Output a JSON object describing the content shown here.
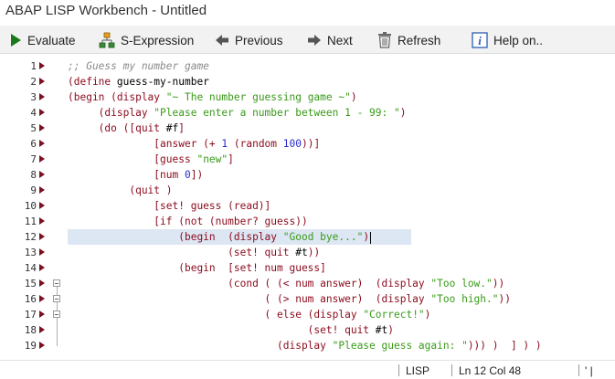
{
  "window": {
    "title": "ABAP LISP Workbench - Untitled"
  },
  "toolbar": {
    "evaluate": "Evaluate",
    "sexpression": "S-Expression",
    "previous": "Previous",
    "next": "Next",
    "refresh": "Refresh",
    "help": "Help on.."
  },
  "colors": {
    "keyword": "#8b0a1c",
    "string": "#3a9a1a",
    "number": "#2a2ad0",
    "comment": "#8a8a8a",
    "current_line": "#dde6f3"
  },
  "editor": {
    "current_line": 12,
    "lines": [
      {
        "n": "1",
        "tokens": [
          {
            "t": ";; Guess my number game",
            "c": "cm"
          }
        ]
      },
      {
        "n": "2",
        "tokens": [
          {
            "t": "(define ",
            "c": "kw"
          },
          {
            "t": "guess-my-number",
            "c": "sy"
          }
        ]
      },
      {
        "n": "3",
        "tokens": [
          {
            "t": "(begin (display ",
            "c": "kw"
          },
          {
            "t": "\"~ The number guessing game ~\"",
            "c": "st"
          },
          {
            "t": ")",
            "c": "kw"
          }
        ]
      },
      {
        "n": "4",
        "tokens": [
          {
            "t": "     (display ",
            "c": "kw"
          },
          {
            "t": "\"Please enter a number between 1 - 99: \"",
            "c": "st"
          },
          {
            "t": ")",
            "c": "kw"
          }
        ]
      },
      {
        "n": "5",
        "tokens": [
          {
            "t": "     (do ([quit ",
            "c": "kw"
          },
          {
            "t": "#f",
            "c": "sy"
          },
          {
            "t": "]",
            "c": "kw"
          }
        ]
      },
      {
        "n": "6",
        "tokens": [
          {
            "t": "              [answer (+ ",
            "c": "kw"
          },
          {
            "t": "1",
            "c": "nm"
          },
          {
            "t": " (random ",
            "c": "kw"
          },
          {
            "t": "100",
            "c": "nm"
          },
          {
            "t": "))]",
            "c": "kw"
          }
        ]
      },
      {
        "n": "7",
        "tokens": [
          {
            "t": "              [guess ",
            "c": "kw"
          },
          {
            "t": "\"new\"",
            "c": "st"
          },
          {
            "t": "]",
            "c": "kw"
          }
        ]
      },
      {
        "n": "8",
        "tokens": [
          {
            "t": "              [num ",
            "c": "kw"
          },
          {
            "t": "0",
            "c": "nm"
          },
          {
            "t": "])",
            "c": "kw"
          }
        ]
      },
      {
        "n": "9",
        "tokens": [
          {
            "t": "          (quit )",
            "c": "kw"
          }
        ]
      },
      {
        "n": "10",
        "tokens": [
          {
            "t": "              [set! guess (read)]",
            "c": "kw"
          }
        ]
      },
      {
        "n": "11",
        "tokens": [
          {
            "t": "              [if (not (number? guess))",
            "c": "kw"
          }
        ]
      },
      {
        "n": "12",
        "tokens": [
          {
            "t": "                  (begin  (display ",
            "c": "kw"
          },
          {
            "t": "\"Good bye...\"",
            "c": "st"
          },
          {
            "t": ")",
            "c": "kw"
          }
        ],
        "caret": true
      },
      {
        "n": "13",
        "tokens": [
          {
            "t": "                          (set! quit ",
            "c": "kw"
          },
          {
            "t": "#t",
            "c": "sy"
          },
          {
            "t": "))",
            "c": "kw"
          }
        ]
      },
      {
        "n": "14",
        "tokens": [
          {
            "t": "                  (begin  [set! num guess]",
            "c": "kw"
          }
        ]
      },
      {
        "n": "15",
        "tokens": [
          {
            "t": "                          (cond ( (< num answer)  (display ",
            "c": "kw"
          },
          {
            "t": "\"Too low.\"",
            "c": "st"
          },
          {
            "t": "))",
            "c": "kw"
          }
        ]
      },
      {
        "n": "16",
        "tokens": [
          {
            "t": "                                ( (> num answer)  (display ",
            "c": "kw"
          },
          {
            "t": "\"Too high.\"",
            "c": "st"
          },
          {
            "t": "))",
            "c": "kw"
          }
        ]
      },
      {
        "n": "17",
        "tokens": [
          {
            "t": "                                ( else (display ",
            "c": "kw"
          },
          {
            "t": "\"Correct!\"",
            "c": "st"
          },
          {
            "t": ")",
            "c": "kw"
          }
        ]
      },
      {
        "n": "18",
        "tokens": [
          {
            "t": "                                       (set! quit ",
            "c": "kw"
          },
          {
            "t": "#t",
            "c": "sy"
          },
          {
            "t": ")",
            "c": "kw"
          }
        ]
      },
      {
        "n": "19",
        "tokens": [
          {
            "t": "                                  (display ",
            "c": "kw"
          },
          {
            "t": "\"Please guess again: \"",
            "c": "st"
          },
          {
            "t": "))) )  ] ) )",
            "c": "kw"
          }
        ]
      }
    ]
  },
  "status": {
    "language": "LISP",
    "position": "Ln  12 Col  48",
    "tail": "' |"
  }
}
